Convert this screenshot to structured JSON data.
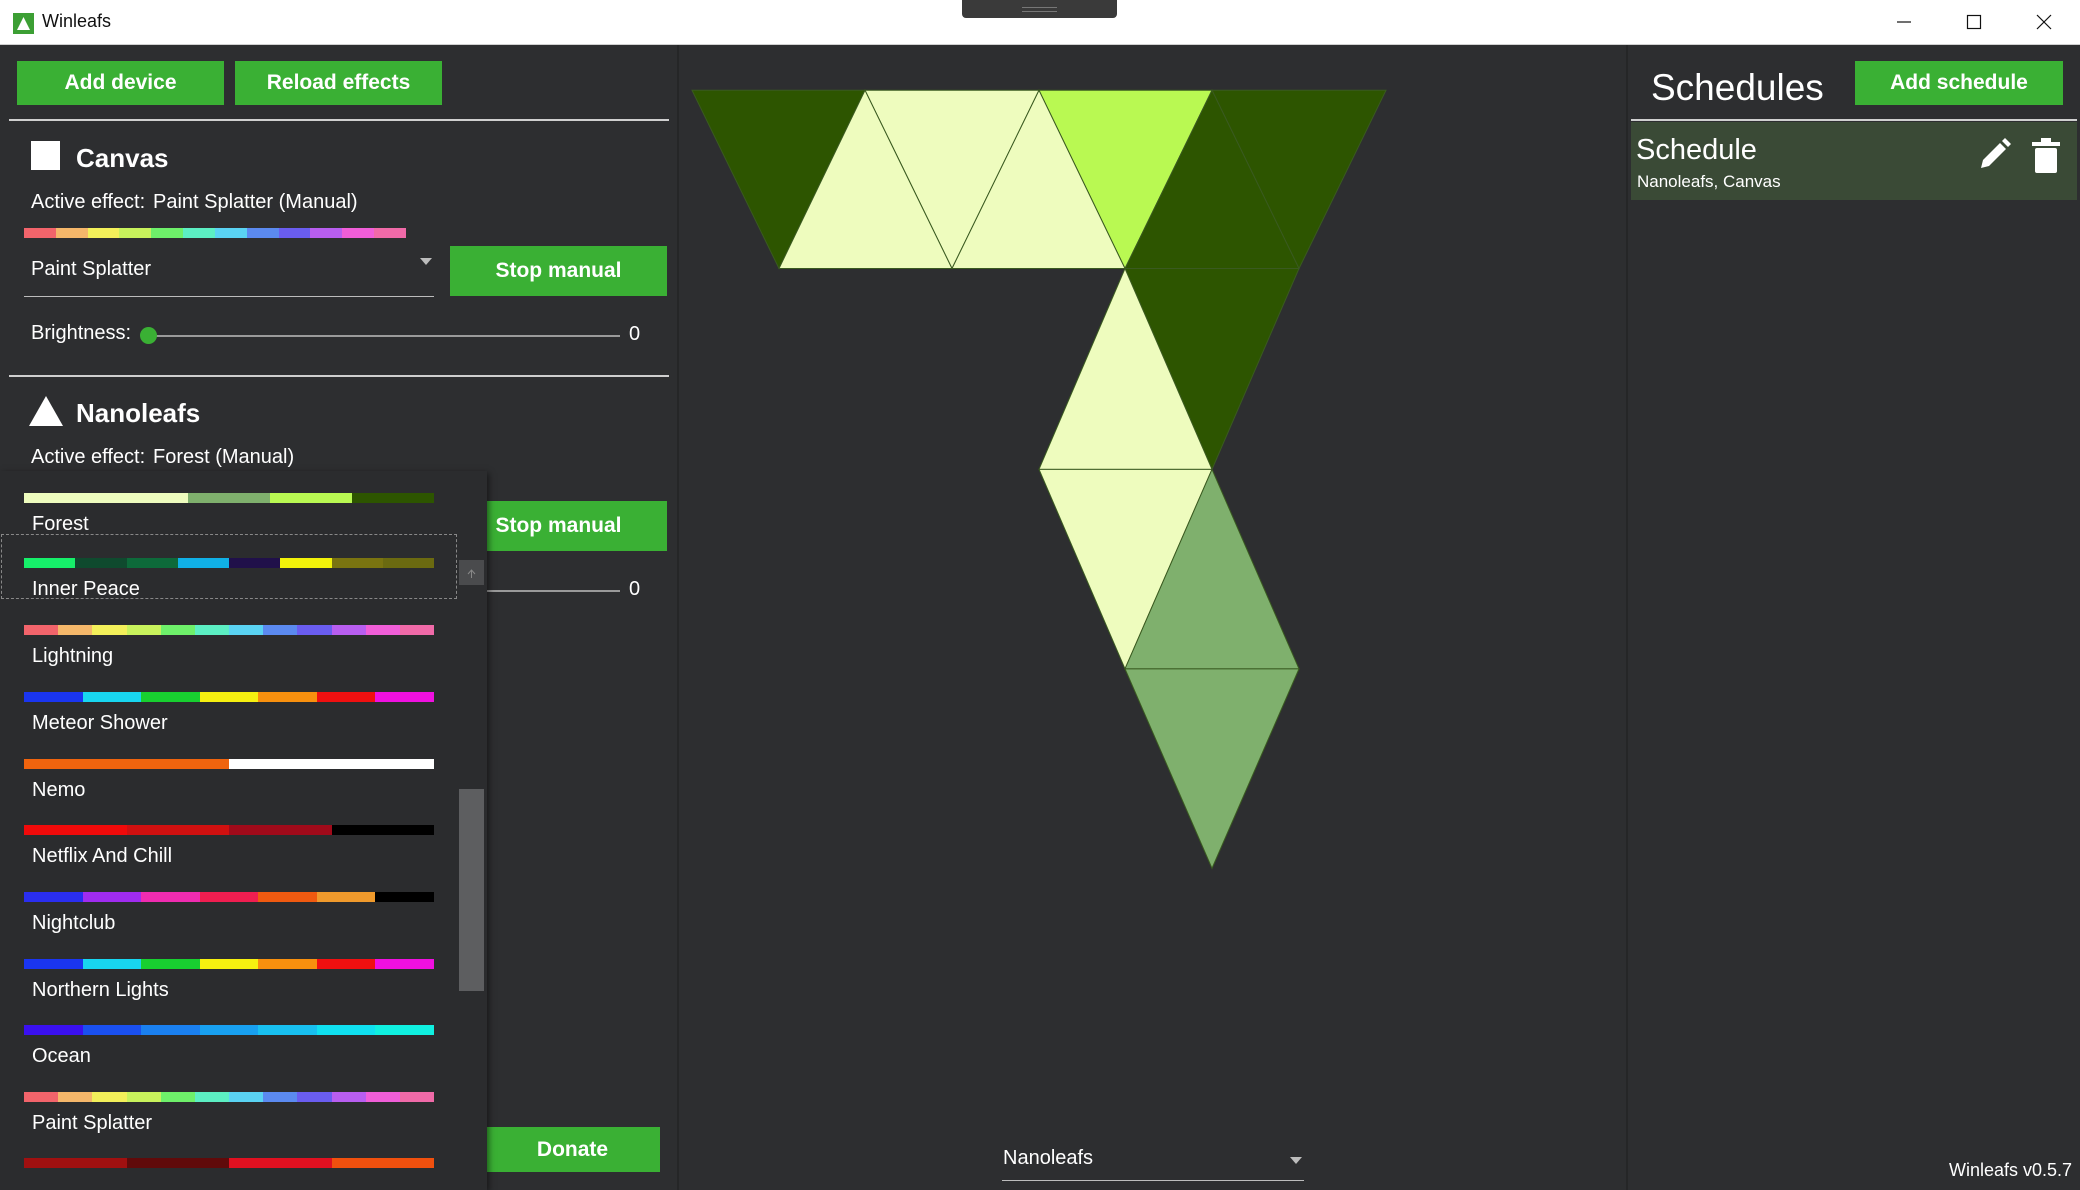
{
  "window": {
    "title": "Winleafs"
  },
  "toolbar": {
    "add_device_label": "Add device",
    "reload_effects_label": "Reload effects"
  },
  "devices": [
    {
      "name": "Canvas",
      "icon": "square-icon",
      "active_effect_label": "Active effect:",
      "active_effect_value": "Paint Splatter (Manual)",
      "selected_effect": "Paint Splatter",
      "stop_label": "Stop manual",
      "brightness_label": "Brightness:",
      "brightness_value": "0"
    },
    {
      "name": "Nanoleafs",
      "icon": "triangle-icon",
      "active_effect_label": "Active effect:",
      "active_effect_value": "Forest (Manual)",
      "stop_label": "Stop manual",
      "brightness_value": "0"
    }
  ],
  "effects_dropdown": {
    "items": [
      {
        "name": "Forest",
        "colors": [
          "#eefcbe",
          "#eefcbe",
          "#7fb06d",
          "#b9f952",
          "#2d5500"
        ]
      },
      {
        "name": "Inner Peace",
        "colors": [
          "#16f06a",
          "#0f4a2e",
          "#0d6a3a",
          "#10b0e6",
          "#20104a",
          "#f2f20a",
          "#7a7410",
          "#6b6a10"
        ]
      },
      {
        "name": "Lightning",
        "colors": [
          "#f2646b",
          "#f5b76a",
          "#f3f05a",
          "#c8f25c",
          "#6ef06a",
          "#5cefc3",
          "#5ad3f3",
          "#5b8af0",
          "#6a5df0",
          "#b85ef0",
          "#f05ed8",
          "#f06aa8"
        ]
      },
      {
        "name": "Meteor Shower",
        "colors": [
          "#1a35f0",
          "#18d6f0",
          "#18d030",
          "#f6f010",
          "#f8900e",
          "#f01010",
          "#f010e0"
        ]
      },
      {
        "name": "Nemo",
        "colors": [
          "#f0640e",
          "#f0640e",
          "#ffffff",
          "#ffffff"
        ]
      },
      {
        "name": "Netflix And Chill",
        "colors": [
          "#f00a0a",
          "#d01010",
          "#a00a1a",
          "#000000"
        ]
      },
      {
        "name": "Nightclub",
        "colors": [
          "#2a2ef0",
          "#a02cf0",
          "#f02cb0",
          "#f01e50",
          "#f05a10",
          "#f09a2c",
          "#000000"
        ]
      },
      {
        "name": "Northern Lights",
        "colors": [
          "#1a35f0",
          "#18d6f0",
          "#18d030",
          "#f6f010",
          "#f8900e",
          "#f01010",
          "#f010e0"
        ]
      },
      {
        "name": "Ocean",
        "colors": [
          "#3a10f0",
          "#1a50f0",
          "#1a80f0",
          "#18a0f0",
          "#18c0f0",
          "#10e0f0",
          "#10f0e0"
        ]
      },
      {
        "name": "Paint Splatter",
        "colors": [
          "#f2646b",
          "#f5b76a",
          "#f3f05a",
          "#c8f25c",
          "#6ef06a",
          "#5cefc3",
          "#5ad3f3",
          "#5b8af0",
          "#6a5df0",
          "#b85ef0",
          "#f05ed8",
          "#f06aa8"
        ]
      },
      {
        "name": "",
        "colors": [
          "#a01010",
          "#600a0a",
          "#e01020",
          "#f0500e"
        ]
      }
    ]
  },
  "canvas_palette_colors": [
    "#f2646b",
    "#f5b76a",
    "#f3f05a",
    "#c8f25c",
    "#6ef06a",
    "#5cefc3",
    "#5ad3f3",
    "#5b8af0",
    "#6a5df0",
    "#b85ef0",
    "#f05ed8",
    "#f06aa8"
  ],
  "donate_label": "Donate",
  "layout_selector": {
    "selected": "Nanoleafs"
  },
  "schedules": {
    "title": "Schedules",
    "add_label": "Add schedule",
    "items": [
      {
        "name": "Schedule",
        "devices": "Nanoleafs, Canvas"
      }
    ]
  },
  "version": "Winleafs v0.5.7",
  "panel_colors": {
    "dark_green": "#2d5500",
    "pale_yellow": "#eefcbe",
    "lime": "#b9f952",
    "sage": "#7fb06d"
  }
}
